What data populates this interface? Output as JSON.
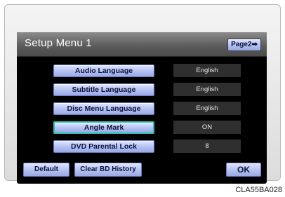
{
  "screen": {
    "title": "Setup Menu 1",
    "page_button_label": "Page2➡"
  },
  "rows": [
    {
      "label": "Audio Language",
      "value": "English"
    },
    {
      "label": "Subtitle Language",
      "value": "English"
    },
    {
      "label": "Disc Menu Language",
      "value": "English"
    },
    {
      "label": "Angle Mark",
      "value": "ON"
    },
    {
      "label": "DVD Parental Lock",
      "value": "8"
    }
  ],
  "buttons": {
    "default": "Default",
    "clear_bd_history": "Clear BD History",
    "ok": "OK"
  },
  "figure_code": "CLA55BA028"
}
